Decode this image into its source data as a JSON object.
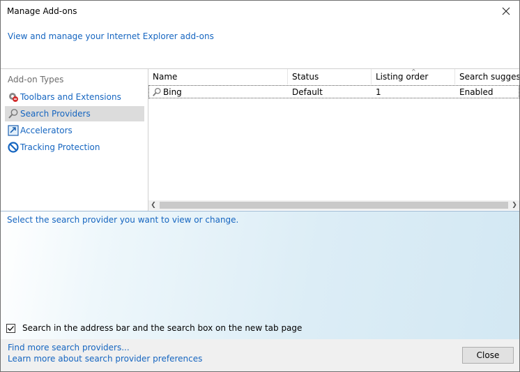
{
  "window": {
    "title": "Manage Add-ons",
    "header_link": "View and manage your Internet Explorer add-ons"
  },
  "sidebar": {
    "title": "Add-on Types",
    "items": [
      {
        "label": "Toolbars and Extensions",
        "icon": "gear-puzzle-icon",
        "selected": false
      },
      {
        "label": "Search Providers",
        "icon": "magnifier-icon",
        "selected": true
      },
      {
        "label": "Accelerators",
        "icon": "accelerator-icon",
        "selected": false
      },
      {
        "label": "Tracking Protection",
        "icon": "no-entry-icon",
        "selected": false
      }
    ]
  },
  "list": {
    "columns": [
      "Name",
      "Status",
      "Listing order",
      "Search suggestic"
    ],
    "rows": [
      {
        "name": "Bing",
        "status": "Default",
        "listing_order": "1",
        "search_suggestions": "Enabled"
      }
    ]
  },
  "details": {
    "prompt": "Select the search provider you want to view or change.",
    "checkbox_label": "Search in the address bar and the search box on the new tab page",
    "checkbox_checked": true
  },
  "footer": {
    "find_more": "Find more search providers...",
    "learn_more": "Learn more about search provider preferences",
    "close_label": "Close"
  },
  "colors": {
    "link": "#1565c0",
    "selected_bg": "#dcdcdc",
    "details_bg": "#d3e8f3",
    "footer_bg": "#f0f0f0"
  }
}
